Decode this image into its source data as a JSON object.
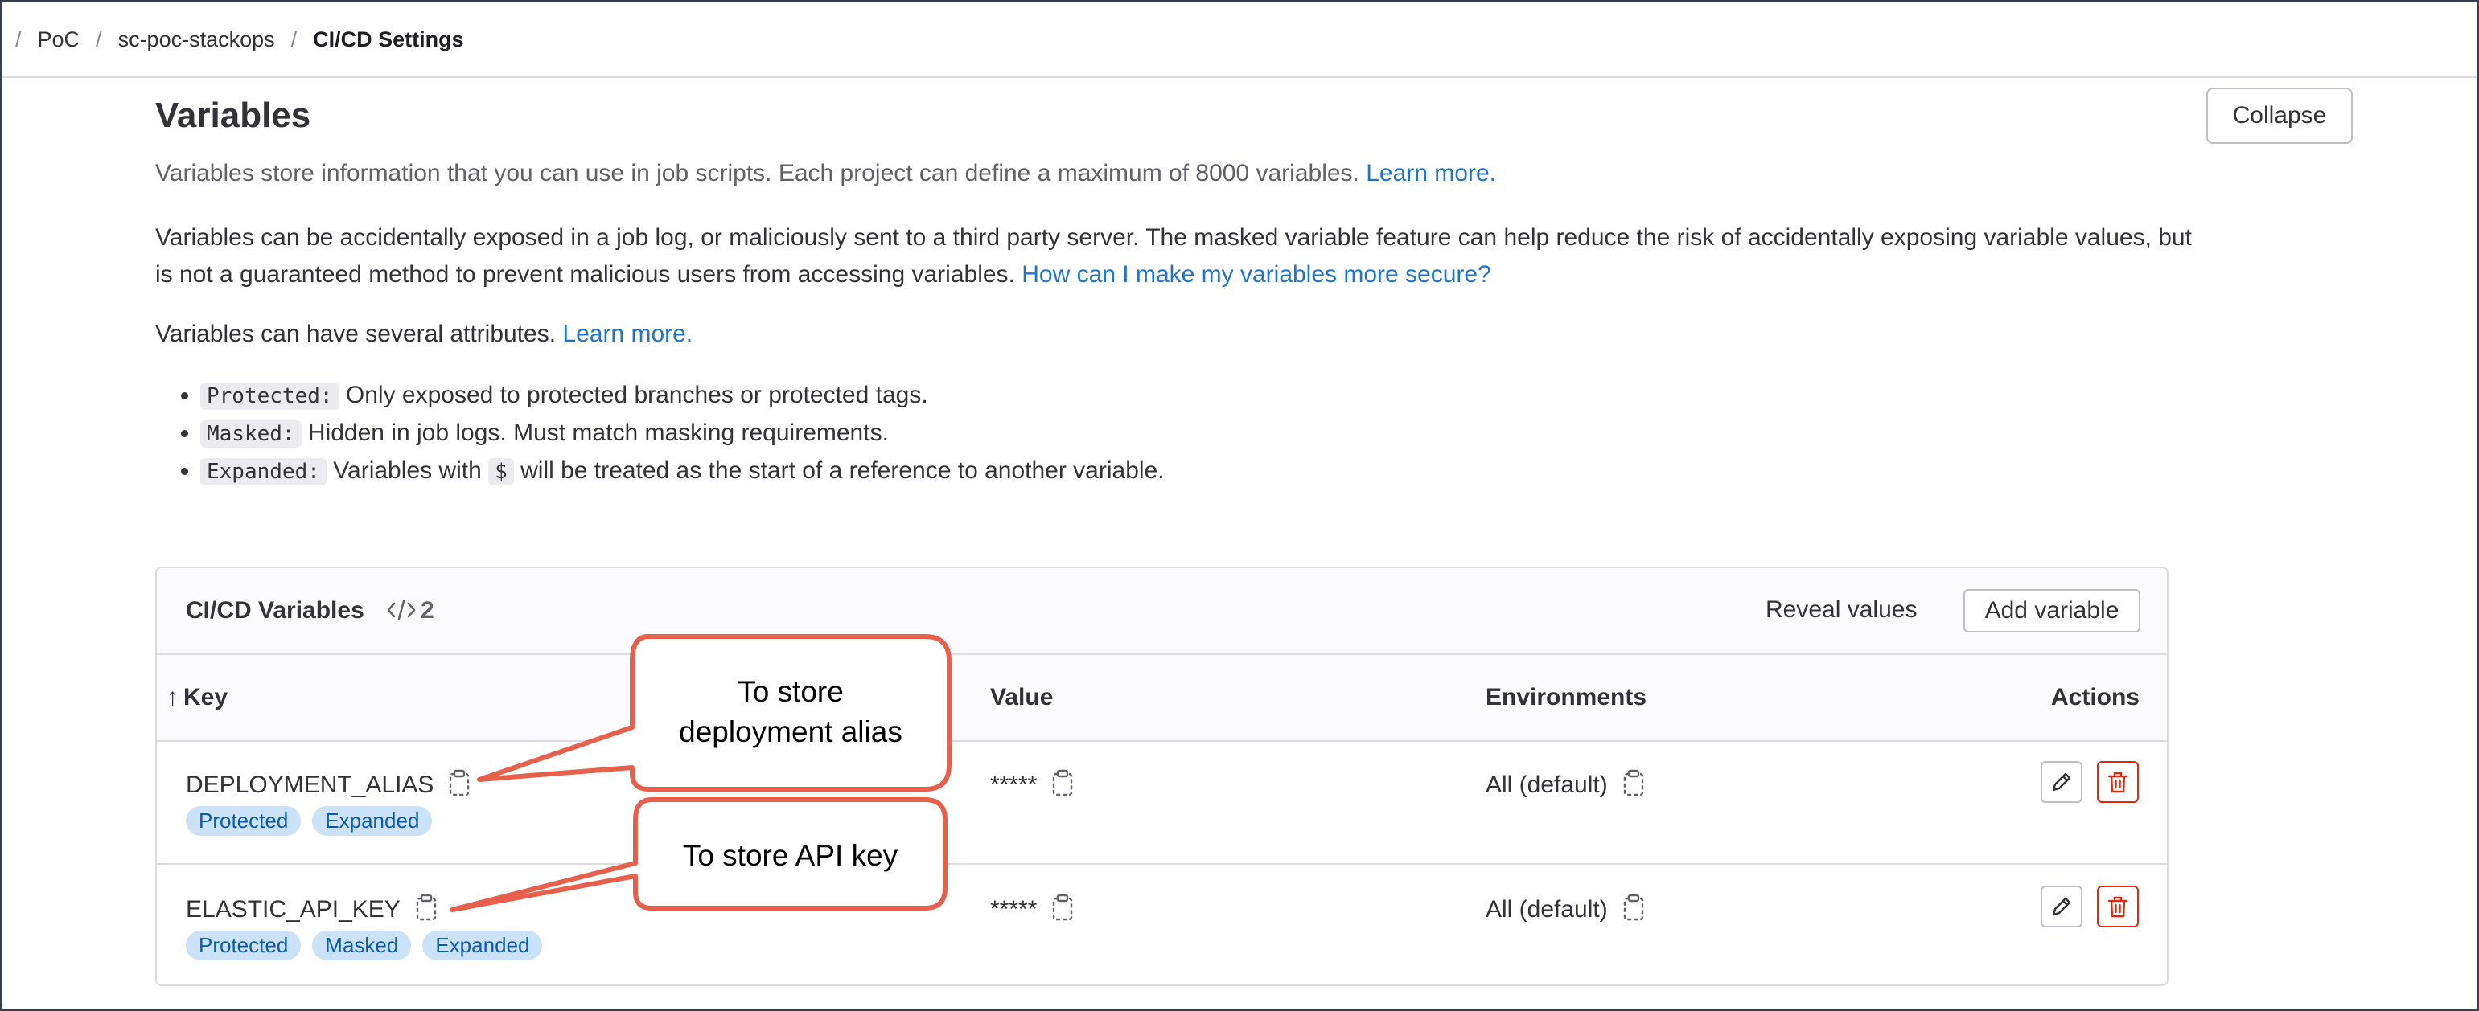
{
  "breadcrumb": {
    "items": [
      "PoC",
      "sc-poc-stackops",
      "CI/CD Settings"
    ]
  },
  "header": {
    "title": "Variables",
    "collapse_label": "Collapse"
  },
  "intro": {
    "lead": "Variables store information that you can use in job scripts. Each project can define a maximum of 8000 variables.",
    "lead_link": "Learn more.",
    "warning": "Variables can be accidentally exposed in a job log, or maliciously sent to a third party server. The masked variable feature can help reduce the risk of accidentally exposing variable values, but is not a guaranteed method to prevent malicious users from accessing variables.",
    "warning_link": "How can I make my variables more secure?",
    "attributes": "Variables can have several attributes.",
    "attributes_link": "Learn more."
  },
  "attributes": [
    {
      "code": "Protected:",
      "text": "Only exposed to protected branches or protected tags."
    },
    {
      "code": "Masked:",
      "text": "Hidden in job logs. Must match masking requirements."
    },
    {
      "code": "Expanded:",
      "text_before": "Variables with",
      "inline_code": "$",
      "text_after": "will be treated as the start of a reference to another variable."
    }
  ],
  "card": {
    "title": "CI/CD Variables",
    "count": "2",
    "reveal_label": "Reveal values",
    "add_label": "Add variable",
    "columns": {
      "key": "Key",
      "value": "Value",
      "environments": "Environments",
      "actions": "Actions"
    },
    "sort_arrow": "↑"
  },
  "rows": [
    {
      "key": "DEPLOYMENT_ALIAS",
      "value": "*****",
      "env": "All (default)",
      "badges": [
        "Protected",
        "Expanded"
      ]
    },
    {
      "key": "ELASTIC_API_KEY",
      "value": "*****",
      "env": "All (default)",
      "badges": [
        "Protected",
        "Masked",
        "Expanded"
      ]
    }
  ],
  "annotations": [
    {
      "line1": "To store",
      "line2": "deployment alias"
    },
    {
      "line1": "To store API key"
    }
  ],
  "colors": {
    "link": "#1f75cb",
    "badge_bg": "#cbe2f9",
    "badge_text": "#0b5cad",
    "delete": "#dd2b0e",
    "callout": "#e8604c"
  },
  "icons": [
    "copy-icon",
    "pencil-icon",
    "trash-icon",
    "code-icon",
    "sort-up-icon"
  ]
}
